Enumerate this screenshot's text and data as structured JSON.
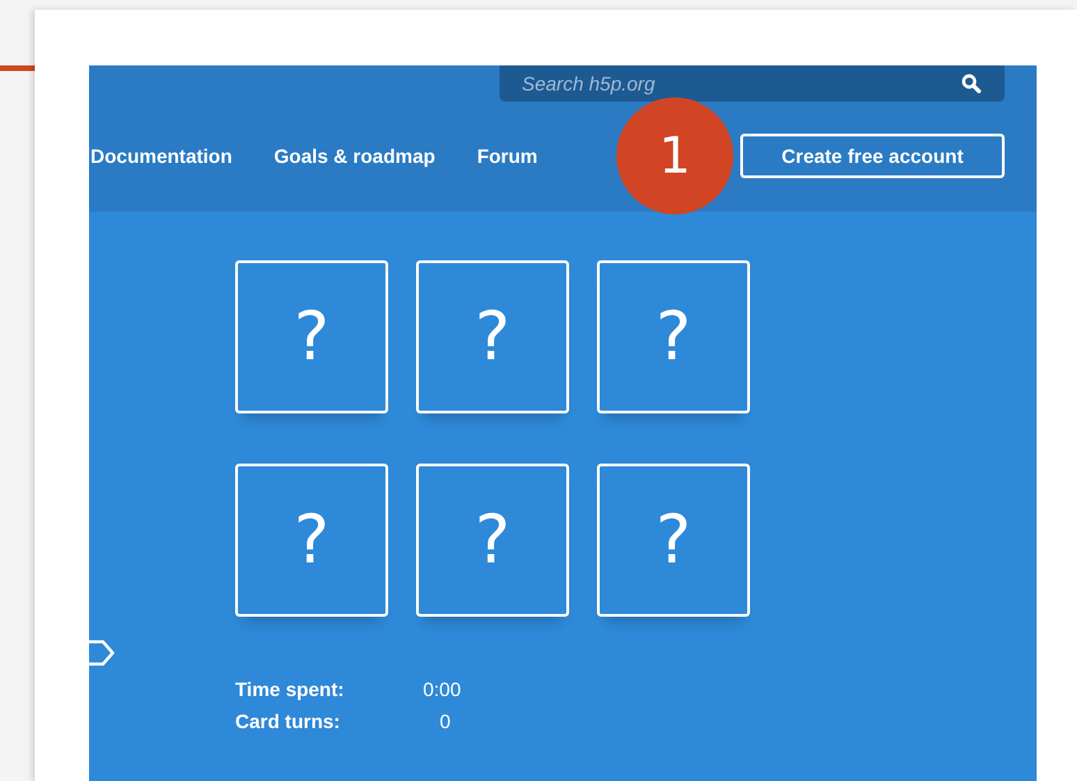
{
  "search": {
    "placeholder": "Search h5p.org"
  },
  "nav": [
    {
      "label": "Documentation"
    },
    {
      "label": "Goals & roadmap"
    },
    {
      "label": "Forum"
    }
  ],
  "account_button": "Create free account",
  "step_badge": "1",
  "cards": [
    {
      "label": "?"
    },
    {
      "label": "?"
    },
    {
      "label": "?"
    },
    {
      "label": "?"
    },
    {
      "label": "?"
    },
    {
      "label": "?"
    }
  ],
  "stats": [
    {
      "label": "Time spent:",
      "value": "0:00"
    },
    {
      "label": "Card turns:",
      "value": "0"
    }
  ]
}
